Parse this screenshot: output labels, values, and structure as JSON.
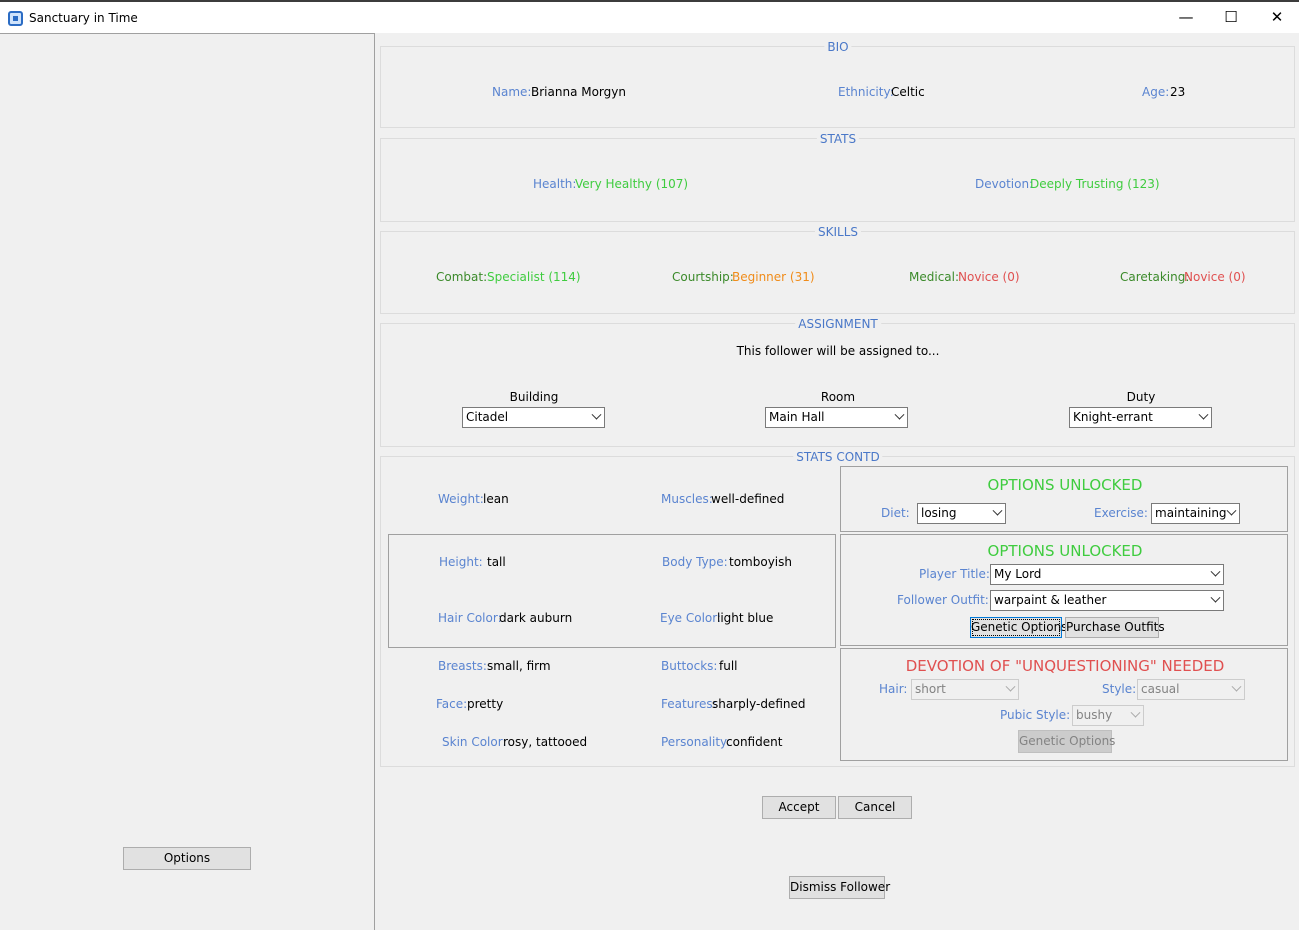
{
  "window": {
    "title": "Sanctuary in Time",
    "minimize": "—",
    "maximize": "☐",
    "close": "✕"
  },
  "left": {
    "options_button": "Options"
  },
  "bio": {
    "legend": "BIO",
    "name_label": "Name:",
    "name": "Brianna Morgyn",
    "ethnicity_label": "Ethnicity:",
    "ethnicity": "Celtic",
    "age_label": "Age:",
    "age": "23"
  },
  "stats": {
    "legend": "STATS",
    "health_label": "Health:",
    "health": "Very Healthy (107)",
    "devotion_label": "Devotion:",
    "devotion": "Deeply Trusting (123)"
  },
  "skills": {
    "legend": "SKILLS",
    "combat_label": "Combat:",
    "combat": "Specialist (114)",
    "courtship_label": "Courtship:",
    "courtship": "Beginner (31)",
    "medical_label": "Medical:",
    "medical": "Novice (0)",
    "caretaking_label": "Caretaking:",
    "caretaking": "Novice (0)"
  },
  "assignment": {
    "legend": "ASSIGNMENT",
    "intro": "This follower will be assigned to...",
    "building_label": "Building",
    "building": "Citadel",
    "room_label": "Room",
    "room": "Main Hall",
    "duty_label": "Duty",
    "duty": "Knight-errant"
  },
  "contd": {
    "legend": "STATS CONTD",
    "weight_label": "Weight:",
    "weight": "lean",
    "muscles_label": "Muscles:",
    "muscles": "well-defined",
    "height_label": "Height:",
    "height": "tall",
    "bodytype_label": "Body Type:",
    "bodytype": "tomboyish",
    "haircolor_label": "Hair Color:",
    "haircolor": "dark auburn",
    "eyecolor_label": "Eye Color:",
    "eyecolor": "light blue",
    "breasts_label": "Breasts:",
    "breasts": "small, firm",
    "buttocks_label": "Buttocks:",
    "buttocks": "full",
    "face_label": "Face:",
    "face": "pretty",
    "features_label": "Features:",
    "features": "sharply-defined",
    "skincolor_label": "Skin Color:",
    "skincolor": "rosy, tattooed",
    "personality_label": "Personality:",
    "personality": "confident"
  },
  "panel1": {
    "headline": "OPTIONS UNLOCKED",
    "diet_label": "Diet:",
    "diet": "losing",
    "exercise_label": "Exercise:",
    "exercise": "maintaining"
  },
  "panel2": {
    "headline": "OPTIONS UNLOCKED",
    "title_label": "Player Title:",
    "title": "My Lord",
    "outfit_label": "Follower Outfit:",
    "outfit": "warpaint & leather",
    "genetic_button": "Genetic Options",
    "purchase_button": "Purchase Outfits"
  },
  "panel3": {
    "headline": "DEVOTION OF \"UNQUESTIONING\" NEEDED",
    "hair_label": "Hair:",
    "hair": "short",
    "style_label": "Style:",
    "style": "casual",
    "pubic_label": "Pubic Style:",
    "pubic": "bushy",
    "genetic_button": "Genetic Options"
  },
  "footer": {
    "accept": "Accept",
    "cancel": "Cancel",
    "dismiss": "Dismiss Follower"
  },
  "colors": {
    "label_blue": "#5a84d0",
    "good_green": "#3fcc3f",
    "dark_green": "#3b8a2a",
    "warn_orange": "#f08c1a",
    "bad_red": "#e05050"
  }
}
